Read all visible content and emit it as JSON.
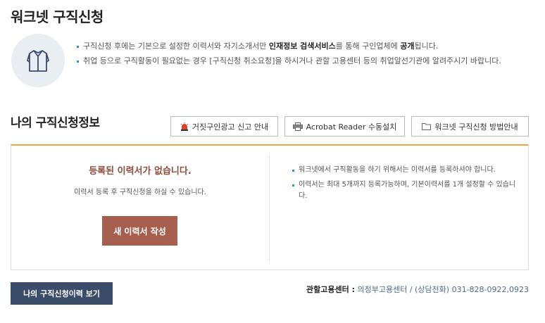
{
  "page": {
    "title": "워크넷 구직신청"
  },
  "notice": {
    "icon": "shirt-icon",
    "items": [
      {
        "before": "구직신청 후에는 기본으로 설정한 이력서와 자기소개서만 ",
        "bold1": "인재정보 검색서비스",
        "middle": "를 통해 구인업체에 ",
        "bold2": "공개",
        "after": "됩니다."
      },
      {
        "text": "취업 등으로 구직활동이 필요없는 경우 [구직신청 취소요청]을 하시거나 관할 고용센터 등의 취업알선기관에 알려주시기 바랍니다."
      }
    ]
  },
  "section": {
    "title": "나의 구직신청정보"
  },
  "toolbar": {
    "report_label": "거짓구인광고 신고 안내",
    "report_icon": "siren-icon",
    "acrobat_label": "Acrobat Reader 수동설치",
    "acrobat_icon": "printer-icon",
    "guide_label": "워크넷 구직신청 방법안내",
    "guide_icon": "folder-icon"
  },
  "panel": {
    "empty_title": "등록된 이력서가 없습니다.",
    "empty_desc": "이력서 등록 후 구직신청을 하실 수 있습니다.",
    "create_button": "새 이력서 작성",
    "notes": [
      "워크넷에서 구직활동을 하기 위해서는 이력서를 등록하셔야 합니다.",
      "이력서는 최대 5개까지 등록가능하며, 기본이력서를 1개 설정할 수 있습니다."
    ]
  },
  "footer": {
    "history_button": "나의 구직신청이력 보기",
    "center_label": "관할고용센터 :",
    "center_value": "의정부고용센터 / (상담전화) 031-828-0922,0923"
  },
  "colors": {
    "accent_orange": "#f0a63c",
    "create_button": "#a65f4f",
    "history_button": "#3b4c6b",
    "bullet_blue": "#3a8bbf",
    "empty_title": "#8f4b3b"
  }
}
